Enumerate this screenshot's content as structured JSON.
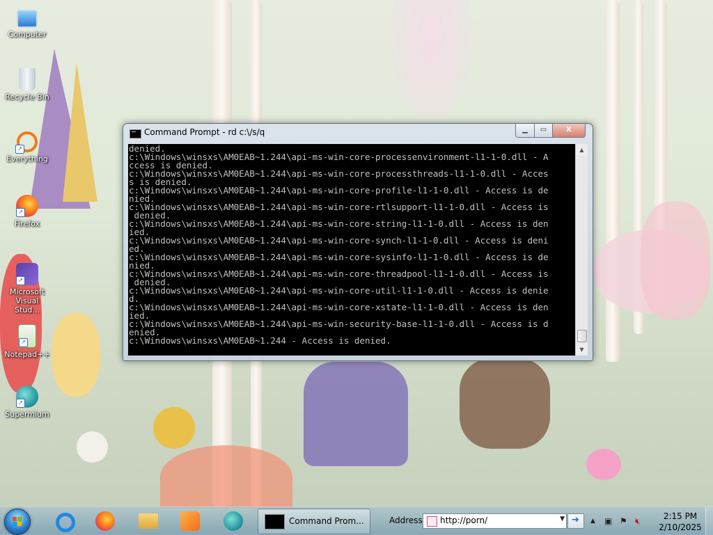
{
  "desktop": {
    "icons": [
      {
        "label": "Computer"
      },
      {
        "label": "Recycle Bin"
      },
      {
        "label": "Everything"
      },
      {
        "label": "Firefox"
      },
      {
        "label": "Microsoft Visual Stud..."
      },
      {
        "label": "Notepad++"
      },
      {
        "label": "Supermium"
      }
    ]
  },
  "cmd_window": {
    "title": "Command Prompt - rd  c:\\/s/q",
    "buttons": {
      "minimize": "▁",
      "maximize": "▭",
      "close": "X"
    },
    "lines": [
      "denied.",
      "c:\\Windows\\winsxs\\AM0EAB~1.244\\api-ms-win-core-processenvironment-l1-1-0.dll - A",
      "ccess is denied.",
      "c:\\Windows\\winsxs\\AM0EAB~1.244\\api-ms-win-core-processthreads-l1-1-0.dll - Acces",
      "s is denied.",
      "c:\\Windows\\winsxs\\AM0EAB~1.244\\api-ms-win-core-profile-l1-1-0.dll - Access is de",
      "nied.",
      "c:\\Windows\\winsxs\\AM0EAB~1.244\\api-ms-win-core-rtlsupport-l1-1-0.dll - Access is",
      " denied.",
      "c:\\Windows\\winsxs\\AM0EAB~1.244\\api-ms-win-core-string-l1-1-0.dll - Access is den",
      "ied.",
      "c:\\Windows\\winsxs\\AM0EAB~1.244\\api-ms-win-core-synch-l1-1-0.dll - Access is deni",
      "ed.",
      "c:\\Windows\\winsxs\\AM0EAB~1.244\\api-ms-win-core-sysinfo-l1-1-0.dll - Access is de",
      "nied.",
      "c:\\Windows\\winsxs\\AM0EAB~1.244\\api-ms-win-core-threadpool-l1-1-0.dll - Access is",
      " denied.",
      "c:\\Windows\\winsxs\\AM0EAB~1.244\\api-ms-win-core-util-l1-1-0.dll - Access is denie",
      "d.",
      "c:\\Windows\\winsxs\\AM0EAB~1.244\\api-ms-win-core-xstate-l1-1-0.dll - Access is den",
      "ied.",
      "c:\\Windows\\winsxs\\AM0EAB~1.244\\api-ms-win-security-base-l1-1-0.dll - Access is d",
      "enied.",
      "c:\\Windows\\winsxs\\AM0EAB~1.244 - Access is denied."
    ]
  },
  "taskbar": {
    "pinned": [
      "internet-explorer-icon",
      "firefox-icon",
      "file-explorer-icon",
      "media-player-icon",
      "supermium-icon"
    ],
    "active_task_label": "Command Prom...",
    "address_label": "Address",
    "address_value": "http://porn/",
    "clock": {
      "time": "2:15 PM",
      "date": "2/10/2025"
    }
  },
  "colors": {
    "console_bg": "#000000",
    "console_fg": "#c0c0c0",
    "close_red": "#d87f6d"
  }
}
